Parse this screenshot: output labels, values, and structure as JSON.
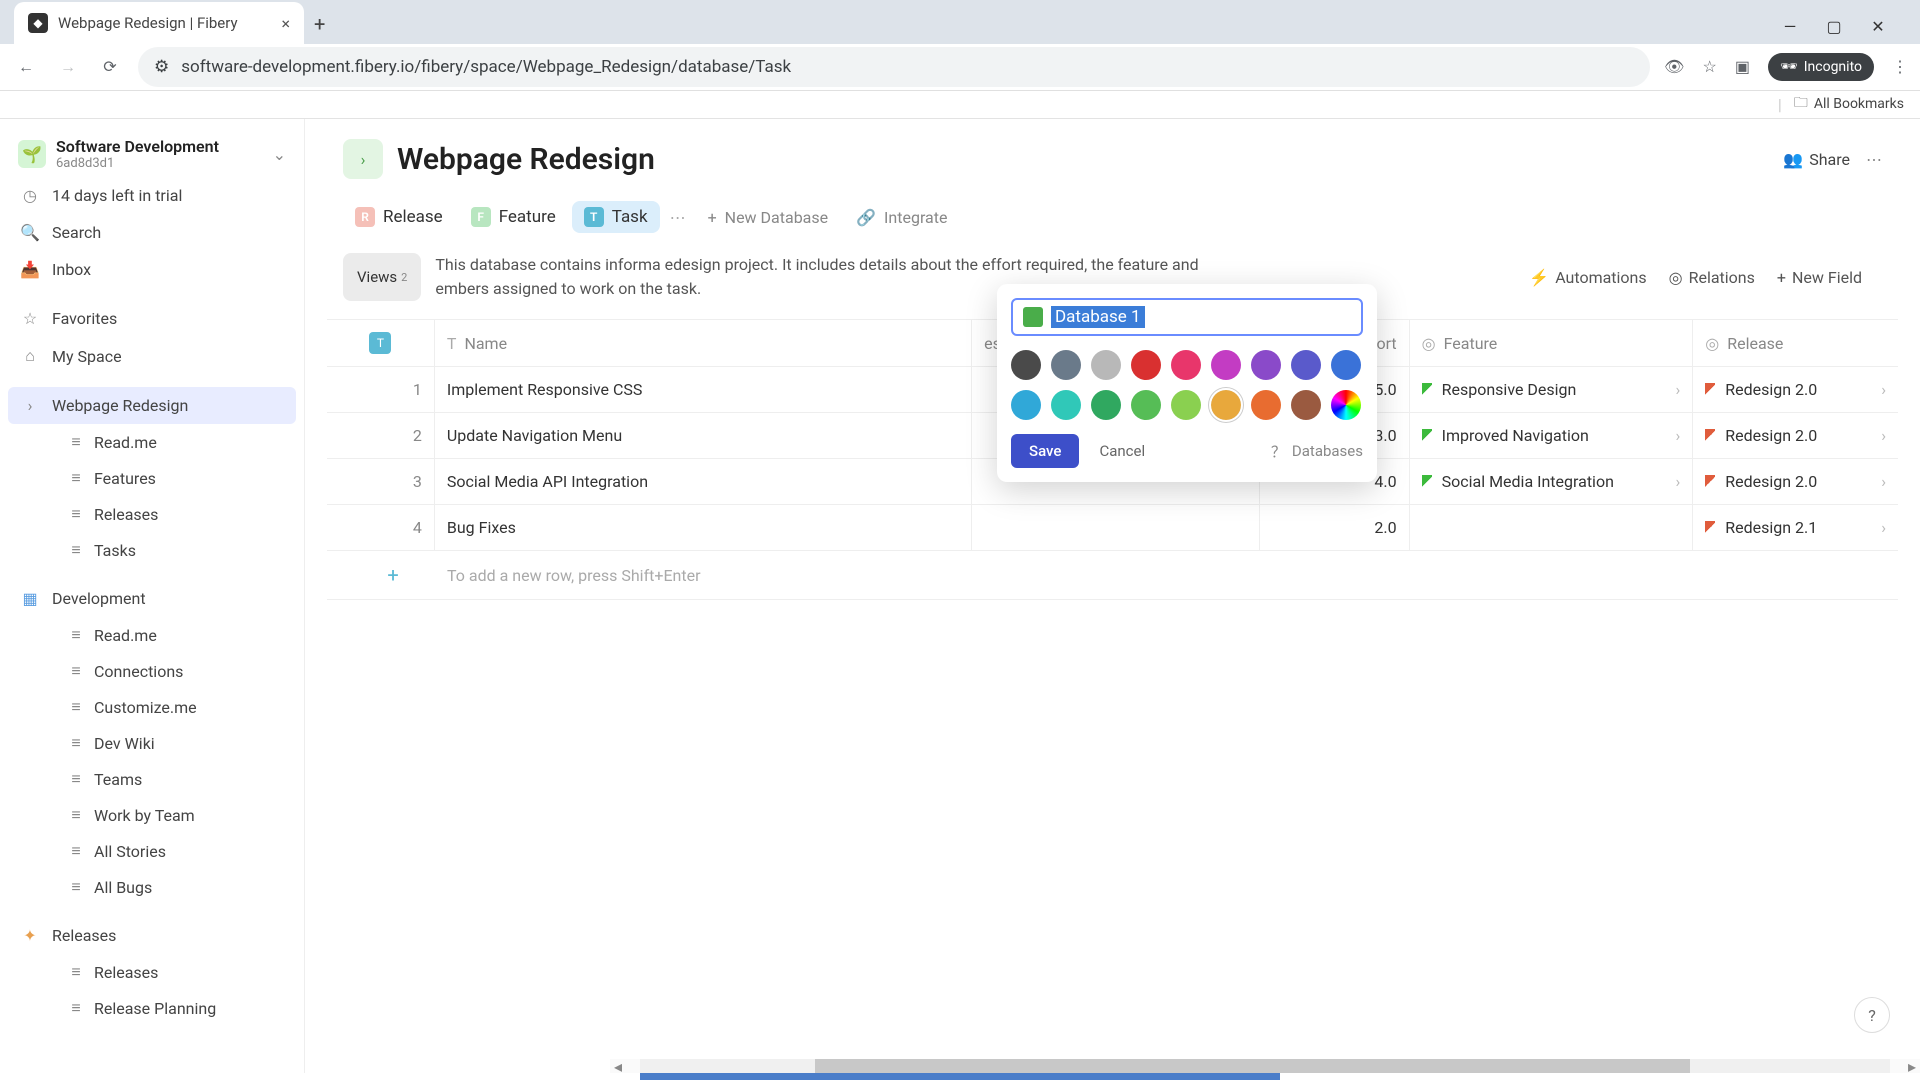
{
  "browser": {
    "tab_title": "Webpage Redesign | Fibery",
    "url": "software-development.fibery.io/fibery/space/Webpage_Redesign/database/Task",
    "incognito": "Incognito",
    "bookmarks": "All Bookmarks"
  },
  "workspace": {
    "title": "Software Development",
    "subtitle": "6ad8d3d1"
  },
  "sidebar": {
    "trial": "14 days left in trial",
    "search": "Search",
    "inbox": "Inbox",
    "favorites": "Favorites",
    "myspace": "My Space",
    "project": "Webpage Redesign",
    "project_children": [
      "Read.me",
      "Features",
      "Releases",
      "Tasks"
    ],
    "development": "Development",
    "dev_children": [
      "Read.me",
      "Connections",
      "Customize.me",
      "Dev Wiki",
      "Teams",
      "Work by Team",
      "All Stories",
      "All Bugs"
    ],
    "releases": "Releases",
    "rel_children": [
      "Releases",
      "Release Planning"
    ]
  },
  "page": {
    "title": "Webpage Redesign",
    "share": "Share",
    "tabs": [
      {
        "label": "Release",
        "color": "#f5c0b8"
      },
      {
        "label": "Feature",
        "color": "#b8e6c0"
      },
      {
        "label": "Task",
        "color": "#5bbad5",
        "active": true
      }
    ],
    "new_database": "New Database",
    "integrate": "Integrate",
    "views_label": "Views",
    "views_count": "2",
    "description": "This database contains informa                                                                               edesign project. It includes details about the effort required, the feature and                                                                               embers assigned to work on the task.",
    "actions": {
      "automations": "Automations",
      "relations": "Relations",
      "newfield": "New Field"
    }
  },
  "table": {
    "columns": {
      "name": "Name",
      "assignees": "es",
      "effort": "Effort",
      "feature": "Feature",
      "release": "Release"
    },
    "rows": [
      {
        "idx": "1",
        "name": "Implement Responsive CSS",
        "effort": "5.0",
        "feature": "Responsive Design",
        "release": "Redesign 2.0"
      },
      {
        "idx": "2",
        "name": "Update Navigation Menu",
        "effort": "3.0",
        "feature": "Improved Navigation",
        "release": "Redesign 2.0"
      },
      {
        "idx": "3",
        "name": "Social Media API Integration",
        "effort": "4.0",
        "feature": "Social Media Integration",
        "release": "Redesign 2.0"
      },
      {
        "idx": "4",
        "name": "Bug Fixes",
        "effort": "2.0",
        "feature": "",
        "release": "Redesign 2.1"
      }
    ],
    "add_row_hint": "To add a new row, press Shift+Enter"
  },
  "popover": {
    "input_value": "Database 1",
    "colors_row1": [
      "#4a4a4a",
      "#6a7a8a",
      "#b8b8b8",
      "#d93030",
      "#e8366b",
      "#c33cc3",
      "#8a4ac9",
      "#5a5acb",
      "#3a72d8"
    ],
    "colors_row2": [
      "#30a8d8",
      "#30c8b8",
      "#30a860",
      "#56bd56",
      "#8ad050",
      "#e8a83c",
      "#e86c30",
      "#9a5a40"
    ],
    "save": "Save",
    "cancel": "Cancel",
    "databases": "Databases"
  }
}
